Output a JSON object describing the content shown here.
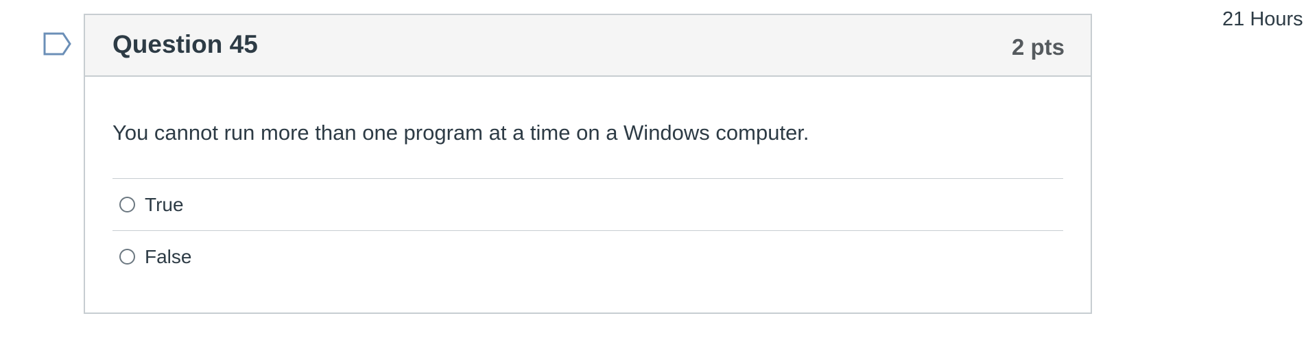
{
  "timer": {
    "text": "21 Hours"
  },
  "question": {
    "title": "Question 45",
    "points": "2 pts",
    "text": "You cannot run more than one program at a time on a Windows computer.",
    "flag_icon": "bookmark-flag-icon",
    "answers": [
      {
        "label": "True"
      },
      {
        "label": "False"
      }
    ]
  },
  "colors": {
    "header_bg": "#f5f5f5",
    "border": "#c7cdd1",
    "text": "#2d3b45",
    "flag": "#6b8fb7"
  }
}
